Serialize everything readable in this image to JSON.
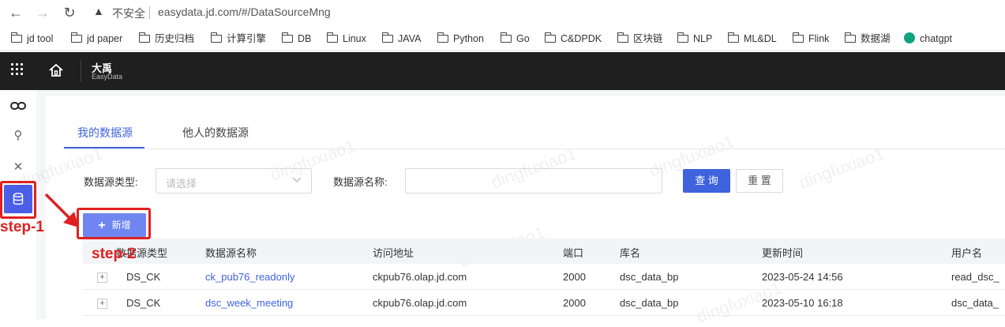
{
  "browser": {
    "insecure_label": "不安全",
    "url": "easydata.jd.com/#/DataSourceMng",
    "bookmarks": [
      "jd tool",
      "jd paper",
      "历史归档",
      "计算引擎",
      "DB",
      "Linux",
      "JAVA",
      "Python",
      "Go",
      "C&DPDK",
      "区块链",
      "NLP",
      "ML&DL",
      "Flink",
      "数据湖",
      "chatgpt"
    ]
  },
  "header": {
    "brand_cn": "大禹",
    "brand_en": "EasyData"
  },
  "tabs": [
    "我的数据源",
    "他人的数据源"
  ],
  "filters": {
    "type_label": "数据源类型:",
    "type_placeholder": "请选择",
    "name_label": "数据源名称:",
    "name_value": "",
    "query_button": "查 询",
    "reset_button": "重 置"
  },
  "add_button": "新增",
  "annotations": {
    "step1": "step-1",
    "step2": "step-2"
  },
  "watermark": "dingfuxiao1",
  "table": {
    "columns": [
      "数据源类型",
      "数据源名称",
      "访问地址",
      "端口",
      "库名",
      "更新时间",
      "用户名"
    ],
    "rows": [
      [
        "DS_CK",
        "ck_pub76_readonly",
        "ckpub76.olap.jd.com",
        "2000",
        "dsc_data_bp",
        "2023-05-24 14:56",
        "read_dsc_"
      ],
      [
        "DS_CK",
        "dsc_week_meeting",
        "ckpub76.olap.jd.com",
        "2000",
        "dsc_data_bp",
        "2023-05-10 16:18",
        "dsc_data_"
      ]
    ]
  },
  "colors": {
    "accent": "#3e63dd",
    "annotation": "#e02020",
    "topbar": "#1f1f1f"
  }
}
